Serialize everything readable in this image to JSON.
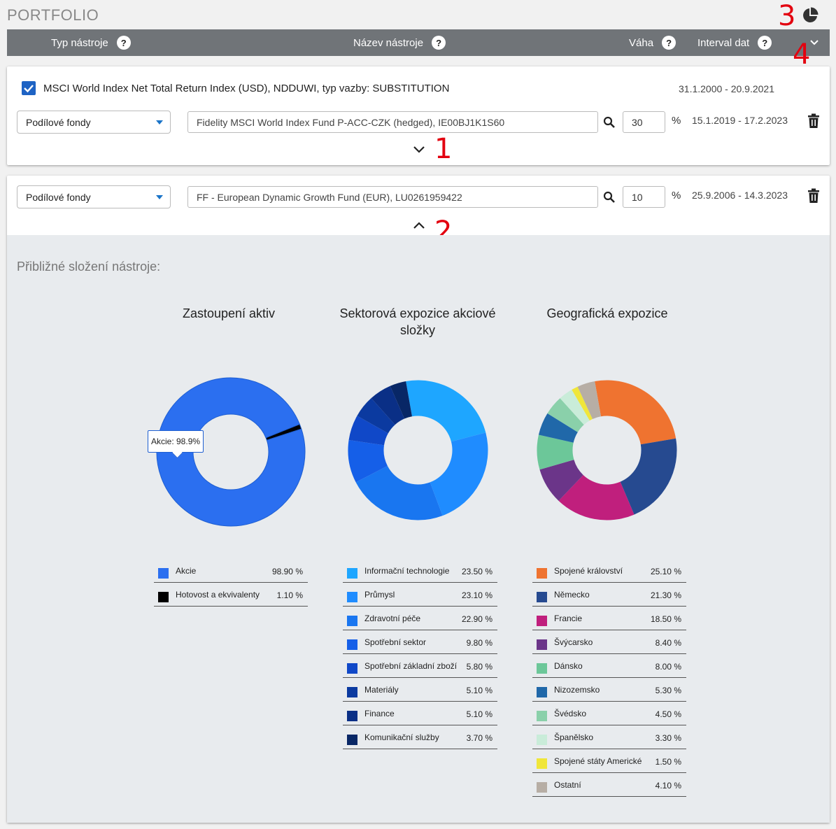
{
  "page": {
    "title": "PORTFOLIO"
  },
  "annotations": [
    "1",
    "2",
    "3",
    "4"
  ],
  "header": {
    "columns": [
      {
        "label": "Typ nástroje",
        "help": "?"
      },
      {
        "label": "Název nástroje",
        "help": "?"
      },
      {
        "label": "Váha",
        "help": "?"
      },
      {
        "label": "Interval dat",
        "help": "?"
      }
    ]
  },
  "index_row": {
    "checked": true,
    "label": "MSCI World Index Net Total Return Index (USD), NDDUWI, typ vazby: SUBSTITUTION",
    "range": "31.1.2000 - 20.9.2021"
  },
  "instruments": [
    {
      "type": "Podílové fondy",
      "name": "Fidelity MSCI World Index Fund P-ACC-CZK (hedged), IE00BJ1K1S60",
      "weight": "30",
      "unit": "%",
      "range": "15.1.2019 - 17.2.2023",
      "expanded": false
    },
    {
      "type": "Podílové fondy",
      "name": "FF - European Dynamic Growth Fund (EUR), LU0261959422",
      "weight": "10",
      "unit": "%",
      "range": "25.9.2006 - 14.3.2023",
      "expanded": true
    }
  ],
  "composition": {
    "title": "Přibližné složení nástroje:",
    "tooltip": "Akcie: 98.9%"
  },
  "chart_data": [
    {
      "type": "pie",
      "title": "Zastoupení aktiv",
      "categories": [
        "Akcie",
        "Hotovost a ekvivalenty"
      ],
      "values": [
        98.9,
        1.1
      ],
      "value_labels": [
        "98.90 %",
        "1.10 %"
      ],
      "colors": [
        "#2b6ff0",
        "#000000"
      ]
    },
    {
      "type": "pie",
      "title": "Sektorová expozice akciové složky",
      "categories": [
        "Informační technologie",
        "Průmysl",
        "Zdravotní péče",
        "Spotřební sektor",
        "Spotřební základní zboží",
        "Materiály",
        "Finance",
        "Komunikační služby"
      ],
      "values": [
        23.5,
        23.1,
        22.9,
        9.8,
        5.8,
        5.1,
        5.1,
        3.7
      ],
      "value_labels": [
        "23.50 %",
        "23.10 %",
        "22.90 %",
        "9.80 %",
        "5.80 %",
        "5.10 %",
        "5.10 %",
        "3.70 %"
      ],
      "colors": [
        "#1ea6ff",
        "#1f8cff",
        "#1976f0",
        "#155fe8",
        "#1048c8",
        "#0b3aa0",
        "#0a2f86",
        "#082766"
      ]
    },
    {
      "type": "pie",
      "title": "Geografická expozice",
      "categories": [
        "Spojené království",
        "Německo",
        "Francie",
        "Švýcarsko",
        "Dánsko",
        "Nizozemsko",
        "Švédsko",
        "Španělsko",
        "Spojené státy Americké",
        "Ostatní"
      ],
      "values": [
        25.1,
        21.3,
        18.5,
        8.4,
        8.0,
        5.3,
        4.5,
        3.3,
        1.5,
        4.1
      ],
      "value_labels": [
        "25.10 %",
        "21.30 %",
        "18.50 %",
        "8.40 %",
        "8.00 %",
        "5.30 %",
        "4.50 %",
        "3.30 %",
        "1.50 %",
        "4.10 %"
      ],
      "colors": [
        "#ef7330",
        "#264a90",
        "#c01f7d",
        "#6b3589",
        "#6cc799",
        "#2068a9",
        "#8ad0aa",
        "#c9ecd9",
        "#f0e63a",
        "#b7aea5"
      ]
    }
  ]
}
